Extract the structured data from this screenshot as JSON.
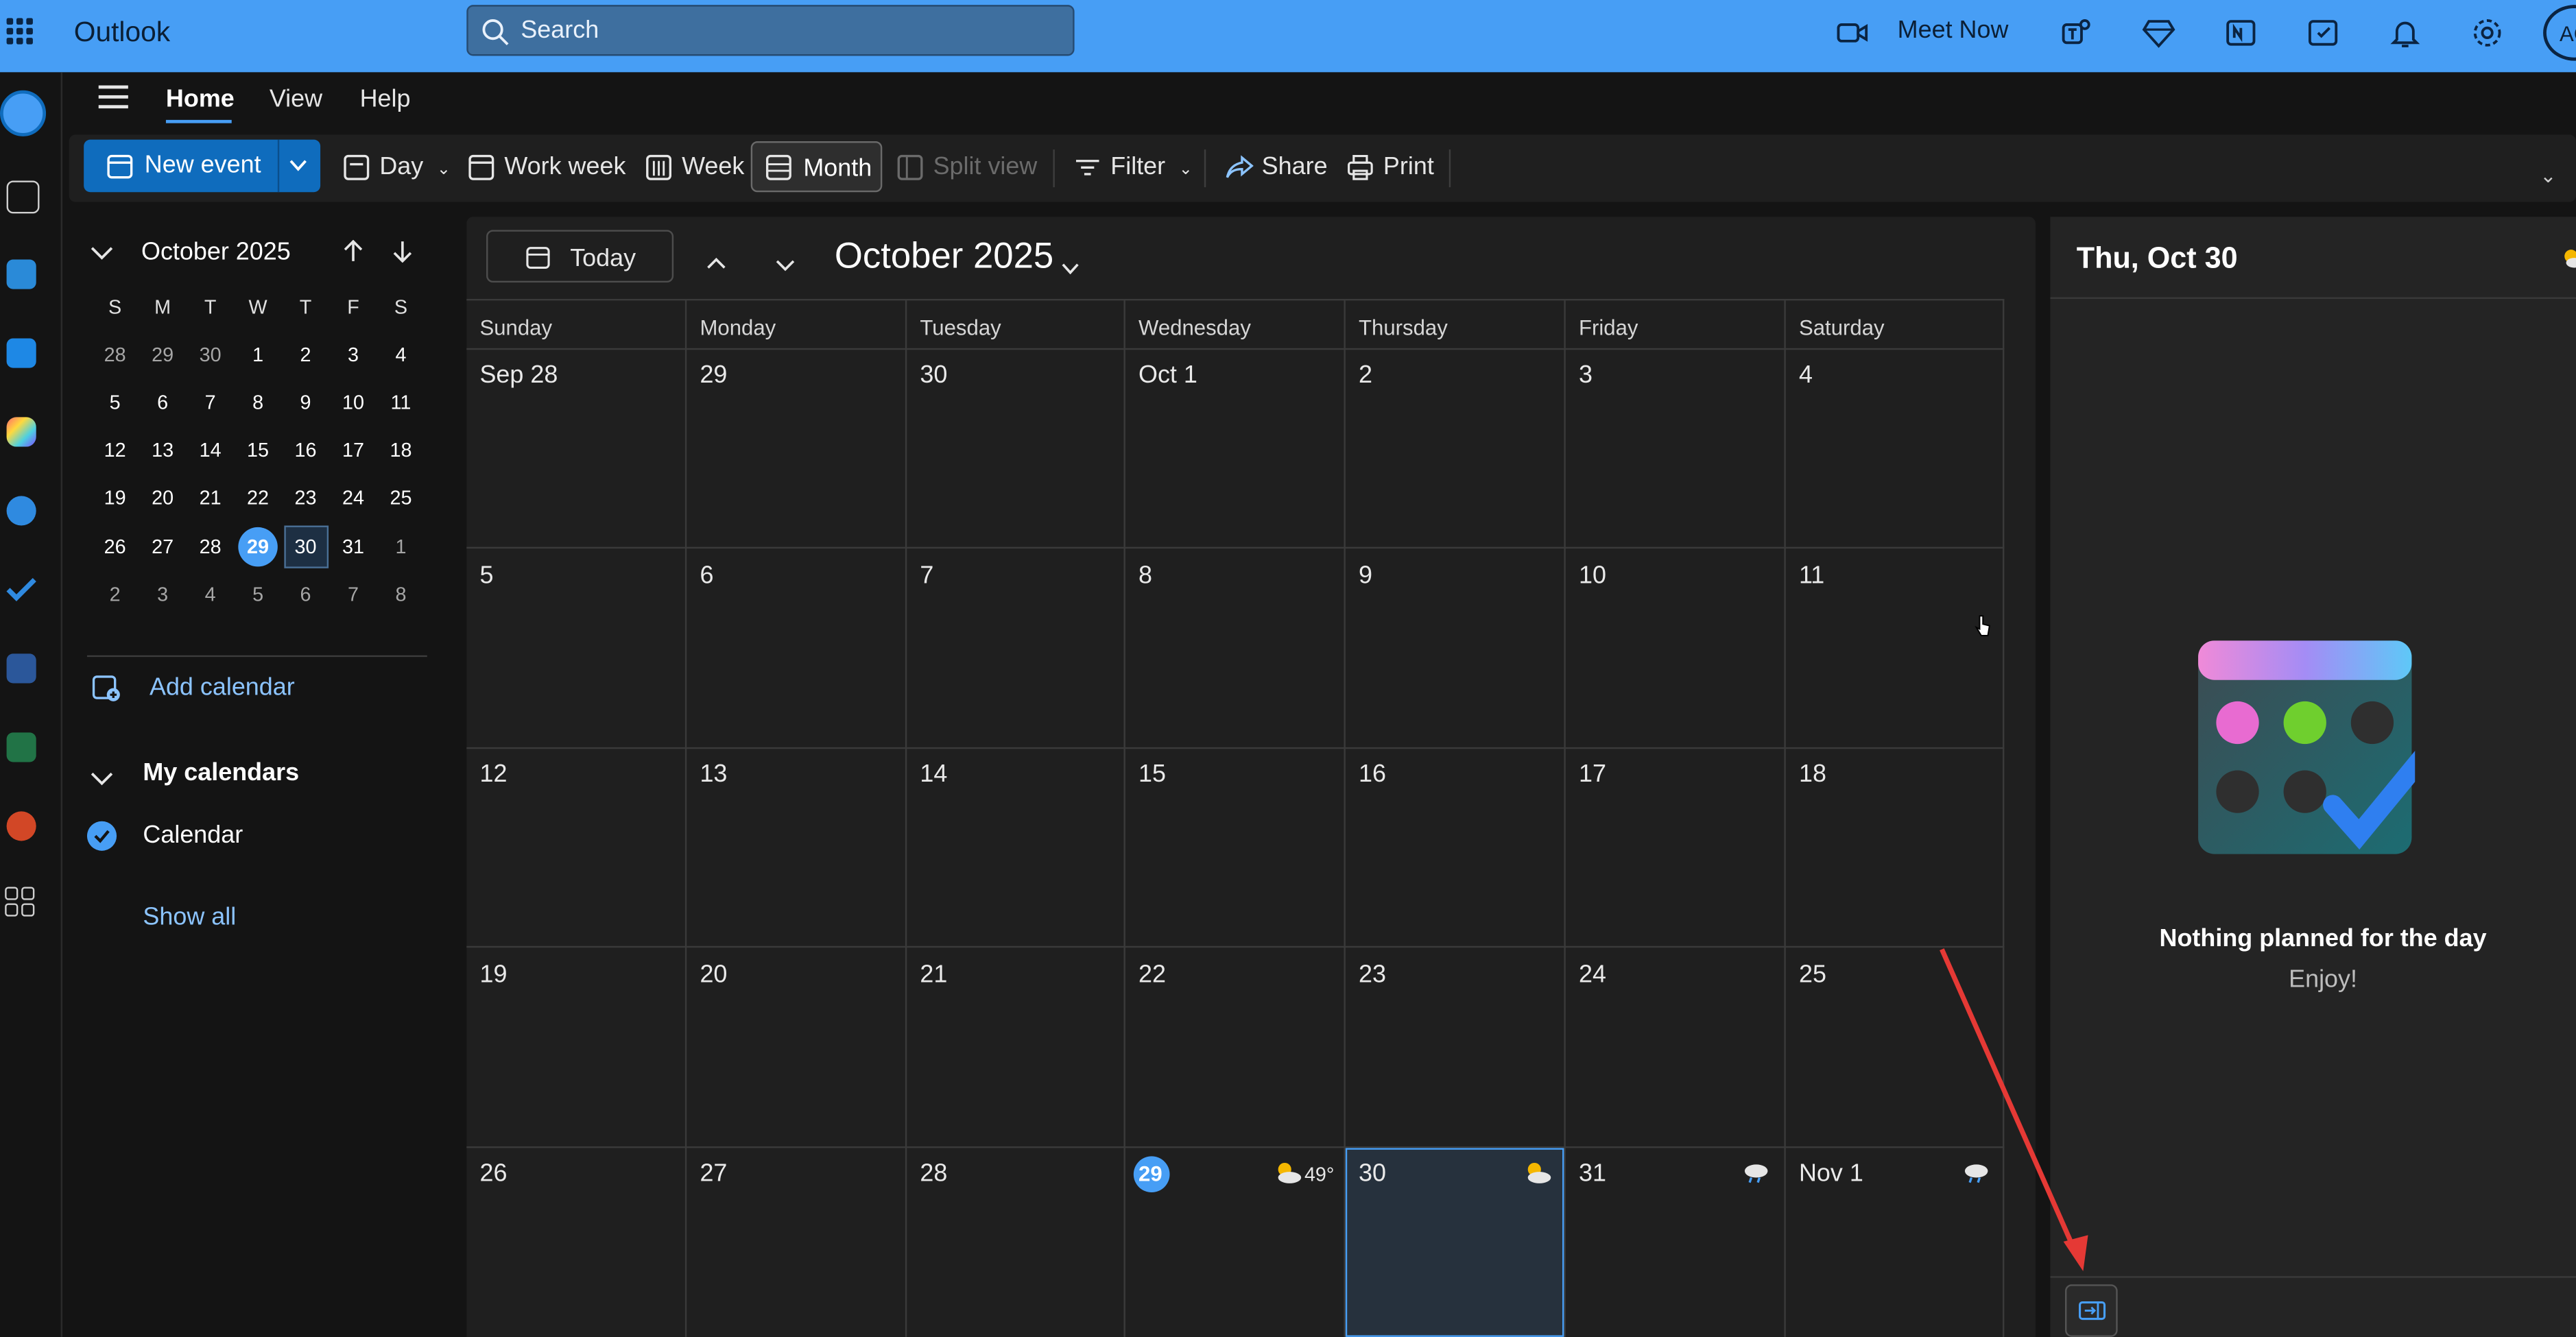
{
  "app": {
    "title": "Outlook",
    "avatar_initials": "AC"
  },
  "search": {
    "label": "Search"
  },
  "topbar": {
    "meet_now": "Meet Now"
  },
  "tabs": [
    "Home",
    "View",
    "Help"
  ],
  "ribbon": {
    "new_event": "New event",
    "day": "Day",
    "work_week": "Work week",
    "week": "Week",
    "month": "Month",
    "split_view": "Split view",
    "filter": "Filter",
    "share": "Share",
    "print": "Print"
  },
  "mini_calendar": {
    "title": "October 2025",
    "weekday_heads": [
      "S",
      "M",
      "T",
      "W",
      "T",
      "F",
      "S"
    ],
    "weeks": [
      [
        "28",
        "29",
        "30",
        "1",
        "2",
        "3",
        "4"
      ],
      [
        "5",
        "6",
        "7",
        "8",
        "9",
        "10",
        "11"
      ],
      [
        "12",
        "13",
        "14",
        "15",
        "16",
        "17",
        "18"
      ],
      [
        "19",
        "20",
        "21",
        "22",
        "23",
        "24",
        "25"
      ],
      [
        "26",
        "27",
        "28",
        "29",
        "30",
        "31",
        "1"
      ],
      [
        "2",
        "3",
        "4",
        "5",
        "6",
        "7",
        "8"
      ]
    ],
    "add_calendar": "Add calendar",
    "my_calendars": "My calendars",
    "calendar_name": "Calendar",
    "show_all": "Show all"
  },
  "main": {
    "today_label": "Today",
    "title": "October 2025",
    "weekdays": [
      "Sunday",
      "Monday",
      "Tuesday",
      "Wednesday",
      "Thursday",
      "Friday",
      "Saturday"
    ],
    "weeks": [
      [
        "Sep 28",
        "29",
        "30",
        "Oct 1",
        "2",
        "3",
        "4"
      ],
      [
        "5",
        "6",
        "7",
        "8",
        "9",
        "10",
        "11"
      ],
      [
        "12",
        "13",
        "14",
        "15",
        "16",
        "17",
        "18"
      ],
      [
        "19",
        "20",
        "21",
        "22",
        "23",
        "24",
        "25"
      ],
      [
        "26",
        "27",
        "28",
        "29",
        "30",
        "31",
        "Nov 1"
      ]
    ],
    "weather_temp": "49°"
  },
  "right_pane": {
    "date": "Thu, Oct 30",
    "empty_title": "Nothing planned for the day",
    "empty_sub": "Enjoy!"
  },
  "colors": {
    "accent": "#479ef5",
    "topbar": "#479ef5",
    "annotation_arrow": "#e53935"
  }
}
